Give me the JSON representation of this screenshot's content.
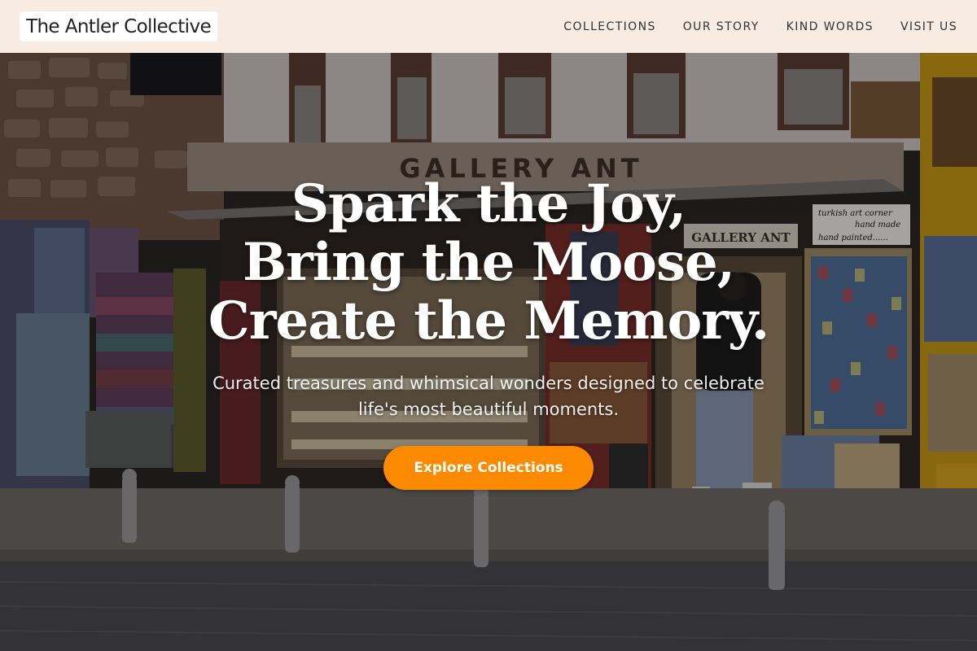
{
  "brand": {
    "name": "The Antler Collective"
  },
  "nav": {
    "items": [
      {
        "label": "COLLECTIONS"
      },
      {
        "label": "OUR STORY"
      },
      {
        "label": "KIND WORDS"
      },
      {
        "label": "VISIT US"
      }
    ]
  },
  "hero": {
    "headline": [
      "Spark the Joy,",
      "Bring the Moose,",
      "Create the Memory."
    ],
    "subtitle": "Curated treasures and whimsical wonders designed to celebrate life's most beautiful moments.",
    "cta_label": "Explore Collections",
    "photo": {
      "storefront_sign": "GALLERY ANT",
      "inner_sign": "GALLERY ANT",
      "shop_card": [
        "turkish art corner",
        "hand made",
        "hand painted......"
      ]
    }
  },
  "colors": {
    "header_bg": "#f8ece2",
    "accent": "#fb8a00",
    "text_dark": "#333333"
  },
  "icons": []
}
